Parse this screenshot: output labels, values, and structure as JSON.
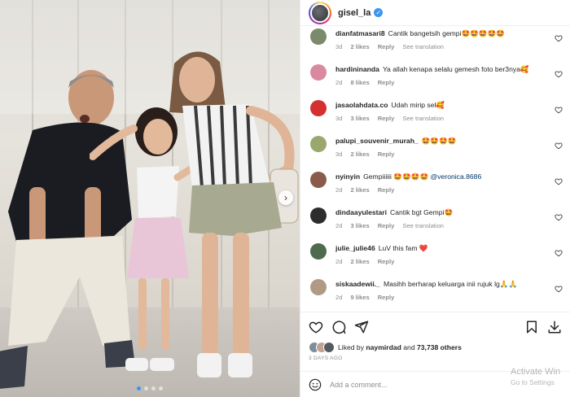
{
  "post": {
    "username": "gisel_la",
    "likes_prefix": "Liked by",
    "liked_by_user": "naymirdad",
    "likes_and": "and",
    "likes_count": "73,738 others",
    "date": "3 DAYS AGO",
    "comment_placeholder": "Add a comment..."
  },
  "comments": [
    {
      "user": "dianfatmasari8",
      "text": "Cantik bangetsih gempi🤩🤩🤩🤩🤩",
      "mention": "",
      "age": "3d",
      "likes": "2 likes",
      "reply": "Reply",
      "translation": "See translation",
      "avatar_color": "#7a8a6a"
    },
    {
      "user": "hardininanda",
      "text": "Ya allah kenapa selalu gemesh foto ber3nya🥰",
      "mention": "",
      "age": "2d",
      "likes": "8 likes",
      "reply": "Reply",
      "translation": "",
      "avatar_color": "#d98aa0"
    },
    {
      "user": "jasaolahdata.co",
      "text": "Udah mirip sel🥰",
      "mention": "",
      "age": "3d",
      "likes": "3 likes",
      "reply": "Reply",
      "translation": "See translation",
      "avatar_color": "#d3302f"
    },
    {
      "user": "palupi_souvenir_murah_",
      "text": "🤩🤩🤩🤩",
      "mention": "",
      "age": "3d",
      "likes": "2 likes",
      "reply": "Reply",
      "translation": "",
      "avatar_color": "#9aa86e"
    },
    {
      "user": "nyinyin",
      "text": "Gempiiiiii 🤩🤩🤩🤩 ",
      "mention": "@veronica.8686",
      "age": "2d",
      "likes": "2 likes",
      "reply": "Reply",
      "translation": "",
      "avatar_color": "#8a5a4a"
    },
    {
      "user": "dindaayulestari",
      "text": "Cantik bgt Gempi🤩",
      "mention": "",
      "age": "2d",
      "likes": "3 likes",
      "reply": "Reply",
      "translation": "See translation",
      "avatar_color": "#2d2d2d"
    },
    {
      "user": "julie_julie46",
      "text": "LuV this fam ❤️",
      "mention": "",
      "age": "2d",
      "likes": "2 likes",
      "reply": "Reply",
      "translation": "",
      "avatar_color": "#4e6b4e"
    },
    {
      "user": "siskaadewii._",
      "text": "Masihh berharap keluarga inii rujuk lg🙏🙏",
      "mention": "",
      "age": "2d",
      "likes": "9 likes",
      "reply": "Reply",
      "translation": "",
      "avatar_color": "#b09a86"
    }
  ],
  "icons": {
    "like": "heart-icon",
    "comment": "comment-icon",
    "share": "share-icon",
    "save": "bookmark-icon",
    "download": "download-icon",
    "emoji": "emoji-icon",
    "more": "more-options-icon",
    "verified": "verified-icon",
    "next": "chevron-right-icon"
  },
  "watermark": {
    "title": "Activate Win",
    "subtitle": "Go to Settings"
  },
  "colors": {
    "accent": "#3897f0",
    "text": "#262626",
    "muted": "#8e8e8e",
    "heart": "#ed4956"
  }
}
